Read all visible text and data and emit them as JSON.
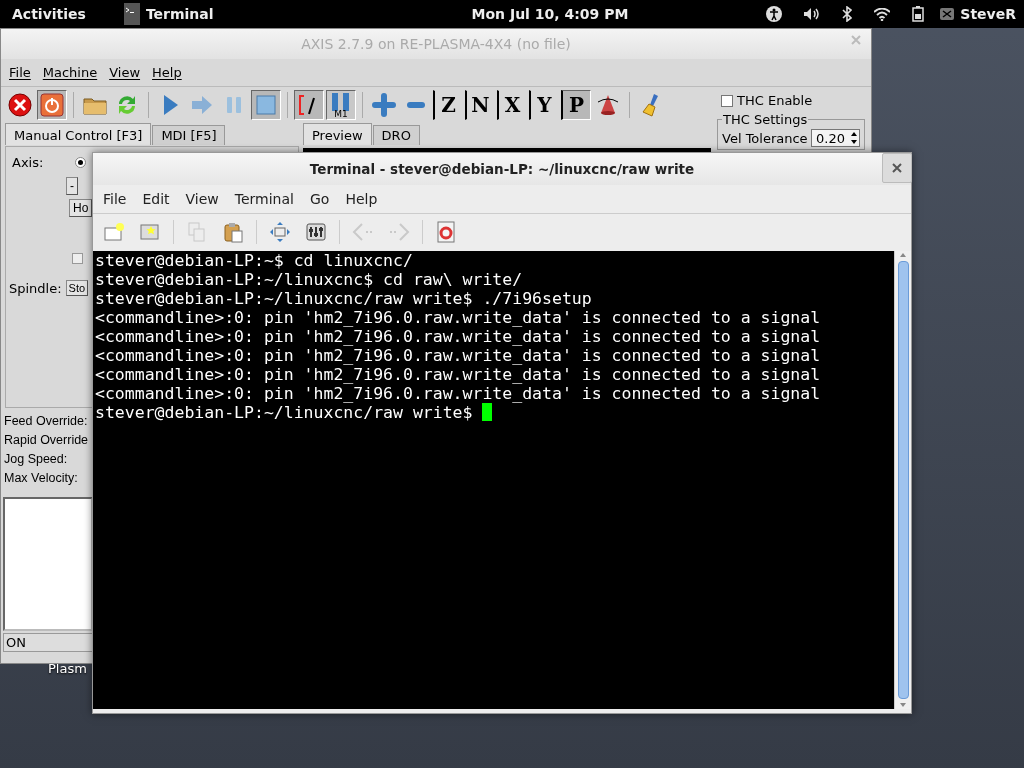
{
  "top_bar": {
    "activities": "Activities",
    "app_name": "Terminal",
    "clock": "Mon Jul 10,  4:09 PM",
    "user": "SteveR"
  },
  "desktop_icon_label": "Plasm",
  "axis_window": {
    "title": "AXIS 2.7.9 on RE-PLASMA-4X4 (no file)",
    "menu": [
      "File",
      "Machine",
      "View",
      "Help"
    ],
    "toolbar_groups": [
      {
        "buttons": [
          {
            "kind": "estop",
            "pressed": false
          },
          {
            "kind": "power",
            "pressed": true
          }
        ]
      },
      {
        "buttons": [
          {
            "kind": "open",
            "pressed": false
          },
          {
            "kind": "reload",
            "pressed": false
          }
        ]
      },
      {
        "buttons": [
          {
            "kind": "run",
            "pressed": false
          },
          {
            "kind": "step",
            "pressed": false
          },
          {
            "kind": "pause",
            "pressed": false
          },
          {
            "kind": "stop",
            "pressed": true
          }
        ]
      },
      {
        "buttons": [
          {
            "kind": "skip",
            "pressed": true
          },
          {
            "kind": "m1",
            "label": "M1",
            "pressed": true
          }
        ]
      },
      {
        "buttons": [
          {
            "kind": "zoomin",
            "pressed": false
          },
          {
            "kind": "zoomout",
            "pressed": false
          },
          {
            "kind": "letter",
            "label": "Z",
            "pressed": false
          },
          {
            "kind": "letter",
            "label": "N",
            "pressed": false
          },
          {
            "kind": "letter",
            "label": "X",
            "pressed": false
          },
          {
            "kind": "letter",
            "label": "Y",
            "pressed": false
          },
          {
            "kind": "letter",
            "label": "P",
            "pressed": true
          },
          {
            "kind": "rotate",
            "pressed": false
          }
        ]
      },
      {
        "buttons": [
          {
            "kind": "clear",
            "pressed": false
          }
        ]
      }
    ],
    "left_tabs": [
      {
        "label": "Manual Control [F3]",
        "selected": true
      },
      {
        "label": "MDI [F5]",
        "selected": false
      }
    ],
    "right_tabs": [
      {
        "label": "Preview",
        "selected": true
      },
      {
        "label": "DRO",
        "selected": false
      }
    ],
    "axis_label": "Axis:",
    "axis_radio": {
      "selected": true
    },
    "jog_minus": "-",
    "home_button": "Ho",
    "option_checkbox": {
      "checked": false
    },
    "spindle_label": "Spindle:",
    "spindle_button": "Sto",
    "overrides": [
      "Feed Override:",
      "Rapid Override",
      "Jog Speed:",
      "Max Velocity:"
    ],
    "status": "ON",
    "thc_enable": {
      "label": "THC Enable",
      "checked": false
    },
    "thc_settings": {
      "title": "THC Settings",
      "vel_tolerance": {
        "label": "Vel Tolerance",
        "value": "0.20"
      }
    }
  },
  "terminal_window": {
    "title": "Terminal - stever@debian-LP: ~/linuxcnc/raw write",
    "menu": [
      "File",
      "Edit",
      "View",
      "Terminal",
      "Go",
      "Help"
    ],
    "toolbar_groups": [
      {
        "buttons": [
          {
            "kind": "new-tab",
            "disabled": false
          },
          {
            "kind": "new-window",
            "disabled": false
          }
        ]
      },
      {
        "buttons": [
          {
            "kind": "copy",
            "disabled": true
          },
          {
            "kind": "paste",
            "disabled": false
          }
        ]
      },
      {
        "buttons": [
          {
            "kind": "fullscreen",
            "disabled": false
          },
          {
            "kind": "settings",
            "disabled": false
          }
        ]
      },
      {
        "buttons": [
          {
            "kind": "back",
            "disabled": true
          },
          {
            "kind": "forward",
            "disabled": true
          }
        ]
      },
      {
        "buttons": [
          {
            "kind": "help",
            "disabled": false
          }
        ]
      }
    ],
    "lines": [
      "stever@debian-LP:~$ cd linuxcnc/",
      "stever@debian-LP:~/linuxcnc$ cd raw\\ write/",
      "stever@debian-LP:~/linuxcnc/raw write$ ./7i96setup",
      "<commandline>:0: pin 'hm2_7i96.0.raw.write_data' is connected to a signal",
      "<commandline>:0: pin 'hm2_7i96.0.raw.write_data' is connected to a signal",
      "<commandline>:0: pin 'hm2_7i96.0.raw.write_data' is connected to a signal",
      "<commandline>:0: pin 'hm2_7i96.0.raw.write_data' is connected to a signal",
      "<commandline>:0: pin 'hm2_7i96.0.raw.write_data' is connected to a signal"
    ],
    "prompt": "stever@debian-LP:~/linuxcnc/raw write$ "
  }
}
